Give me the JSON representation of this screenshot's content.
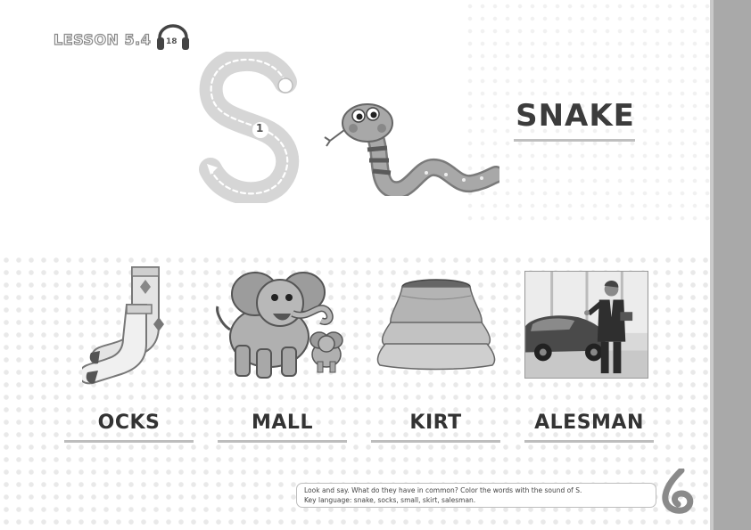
{
  "header": {
    "lesson_label": "LESSON 5.4",
    "audio_track": "18",
    "audio_icon": "headphones-icon"
  },
  "featured": {
    "letter": "S",
    "stroke_number": "1",
    "word": "SNAKE",
    "picture": "snake-illustration"
  },
  "cards": [
    {
      "word": "OCKS",
      "picture": "socks-illustration"
    },
    {
      "word": "MALL",
      "picture": "elephant-illustration"
    },
    {
      "word": "KIRT",
      "picture": "skirt-illustration"
    },
    {
      "word": "ALESMAN",
      "picture": "salesman-photo"
    }
  ],
  "instructions": {
    "line1": "Look and say. What do they have in common? Color the words with the sound of S.",
    "line2": "Key language: snake, socks, small, skirt, salesman."
  },
  "colors": {
    "side_strip": "#a9a9a9",
    "text_dark": "#3c3c3c",
    "underline": "#bdbdbd"
  }
}
